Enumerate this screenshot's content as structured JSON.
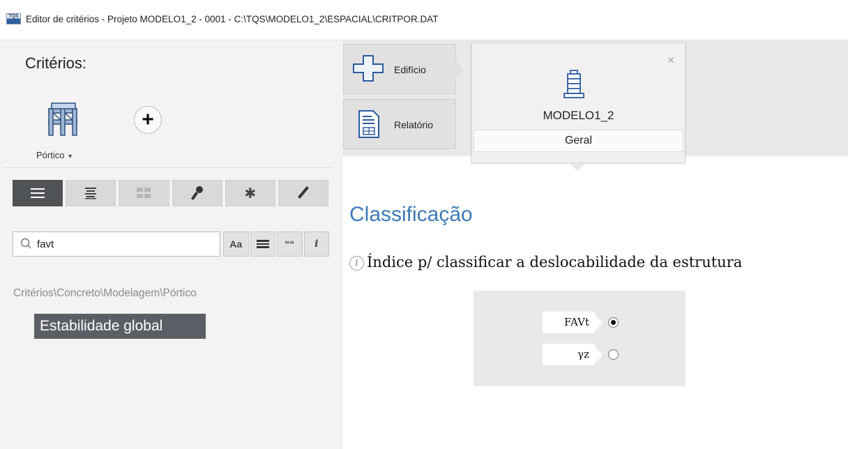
{
  "window": {
    "app_icon_text": "TQS",
    "title": "Editor de critérios - Projeto MODELO1_2 - 0001 - C:\\TQS\\MODELO1_2\\ESPACIAL\\CRITPOR.DAT"
  },
  "left_panel": {
    "header": "Critérios:",
    "criteria_item": {
      "label": "Pórtico",
      "icon": "portico-frame-icon"
    },
    "add_icon": "plus-circle-icon",
    "toolbar": [
      {
        "icon": "list-view-icon",
        "state": "active"
      },
      {
        "icon": "text-lines-icon",
        "state": "normal"
      },
      {
        "icon": "grid-view-icon",
        "state": "disabled"
      },
      {
        "icon": "key-icon",
        "state": "normal"
      },
      {
        "icon": "asterisk-icon",
        "state": "normal"
      },
      {
        "icon": "pencil-icon",
        "state": "normal"
      }
    ],
    "search": {
      "value": "favt",
      "placeholder": ""
    },
    "search_tools": {
      "case_label": "Aa",
      "quote_label": "““",
      "info_label": "i"
    },
    "breadcrumb": "Critérios\\Concreto\\Modelagem\\Pórtico",
    "selected_group": "Estabilidade global"
  },
  "nav": {
    "edificio_label": "Edifício",
    "relatorio_label": "Relatório"
  },
  "card": {
    "name": "MODELO1_2",
    "subtitle": "Geral",
    "close_icon": "close-x-icon"
  },
  "content": {
    "section_title": "Classificação",
    "question": "Índice p/ classificar a deslocabilidade da estrutura",
    "options": [
      {
        "label": "FAVt",
        "selected": true
      },
      {
        "label": "γz",
        "selected": false
      }
    ]
  },
  "colors": {
    "accent_title": "#3e7ab8",
    "selected_bg": "#5a5f66",
    "active_toolbar": "#4f5356"
  }
}
